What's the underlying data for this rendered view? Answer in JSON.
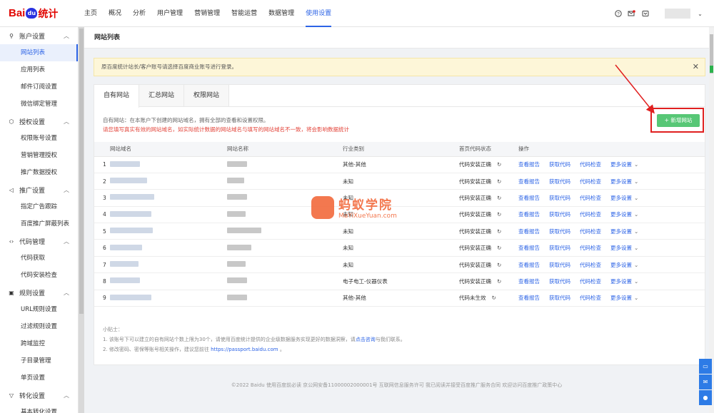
{
  "logo": {
    "part1": "Bai",
    "part2": "du",
    "part3": "统计"
  },
  "nav": [
    "主页",
    "概况",
    "分析",
    "用户管理",
    "营销管理",
    "智能运营",
    "数据管理",
    "使用设置"
  ],
  "nav_active_index": 7,
  "top_icons": [
    "help-icon",
    "mail-icon",
    "message-icon"
  ],
  "sidebar": [
    {
      "label": "账户设置",
      "icon": "user-icon",
      "items": [
        "网站列表",
        "应用列表",
        "邮件订阅设置",
        "微信绑定管理"
      ]
    },
    {
      "label": "授权设置",
      "icon": "cube-icon",
      "items": [
        "权限账号设置",
        "营销管理授权",
        "推广数据授权"
      ]
    },
    {
      "label": "推广设置",
      "icon": "megaphone-icon",
      "items": [
        "指定广告跟踪",
        "百度推广屏蔽列表"
      ]
    },
    {
      "label": "代码管理",
      "icon": "code-icon",
      "items": [
        "代码获取",
        "代码安装检查"
      ]
    },
    {
      "label": "规则设置",
      "icon": "rules-icon",
      "items": [
        "URL规则设置",
        "过滤规则设置",
        "跨域监控",
        "子目录管理",
        "单页设置"
      ]
    },
    {
      "label": "转化设置",
      "icon": "filter-icon",
      "items": [
        "基本转化设置"
      ]
    }
  ],
  "sidebar_active": "网站列表",
  "page_title": "网站列表",
  "notice": "原百度统计站长/客户账号请选择百度商业账号进行登录。",
  "tabs": [
    "自有网站",
    "汇总网站",
    "权限网站"
  ],
  "description": "自有网站：在本账户下创建的网站域名，拥有全部的查看和设置权限。",
  "warning": "请您填写真实有效的网站域名，如实际统计数据的网站域名与填写的网站域名不一致，将会影响数据统计",
  "add_button": "+ 新增网站",
  "table": {
    "headers": [
      "",
      "网站域名",
      "网站名称",
      "行业类别",
      "首页代码状态",
      "操作"
    ],
    "actions": [
      "查看报告",
      "获取代码",
      "代码检查",
      "更多设置"
    ],
    "rows": [
      {
        "no": "1",
        "industry": "其他-其他",
        "status": "代码安装正确"
      },
      {
        "no": "2",
        "industry": "未知",
        "status": "代码安装正确"
      },
      {
        "no": "3",
        "industry": "未知",
        "status": "代码安装正确"
      },
      {
        "no": "4",
        "industry": "未知",
        "status": "代码安装正确"
      },
      {
        "no": "5",
        "industry": "未知",
        "status": "代码安装正确"
      },
      {
        "no": "6",
        "industry": "未知",
        "status": "代码安装正确"
      },
      {
        "no": "7",
        "industry": "未知",
        "status": "代码安装正确"
      },
      {
        "no": "8",
        "industry": "电子电工-仪器仪表",
        "status": "代码安装正确"
      },
      {
        "no": "9",
        "industry": "其他-其他",
        "status": "代码未生效"
      }
    ]
  },
  "tips": {
    "title": "小贴士：",
    "line1_a": "1. 该账号下可以建立的自有网站个数上限为30个，请使用百度统计提供的企业级数据服务实现更好的数据洞察，请",
    "line1_link": "点击咨询",
    "line1_b": "与我们联系。",
    "line2_a": "2. 修改密码、密保等账号相关操作，建议您前往",
    "line2_link": "https://passport.baidu.com",
    "line2_b": "。"
  },
  "footer": "©2022 Baidu 使用百度前必读 京公网安备11000002000001号 互联网信息服务许可 我已阅读并接受百度推广服务合同 欢迎访问百度推广政策中心",
  "watermark": {
    "title": "蚂蚁学院",
    "subtitle": "MaYiXueYuan.com"
  },
  "colors": {
    "accent": "#2d64e6",
    "add_button": "#57c776",
    "warning": "#e3453b",
    "annotation": "#e02020"
  }
}
